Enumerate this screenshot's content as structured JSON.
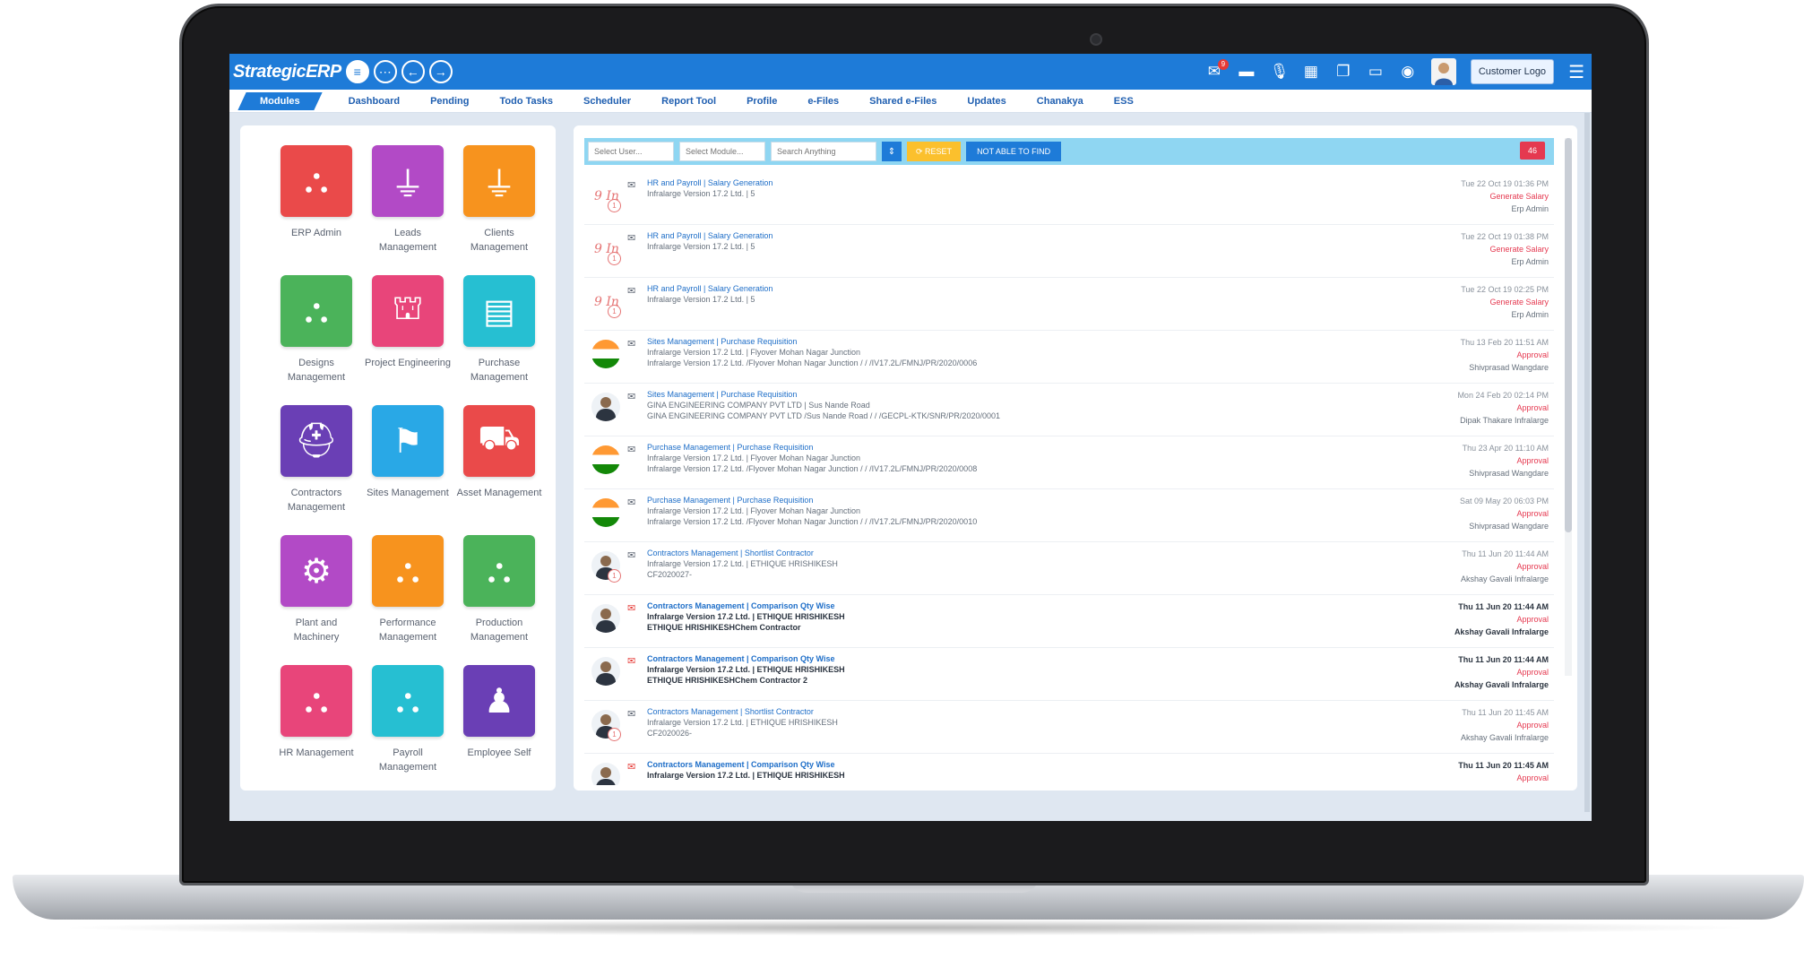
{
  "app": {
    "brand": "StrategicERP",
    "notification_count": "9",
    "customer_logo": "Customer Logo",
    "colors": {
      "topbar": "#1e7bd8",
      "accent_red": "#e53950",
      "reset": "#fbc02d",
      "filter_bar": "#8fd6f2"
    }
  },
  "nav": {
    "tabs": [
      "Modules",
      "Dashboard",
      "Pending",
      "Todo Tasks",
      "Scheduler",
      "Report Tool",
      "Profile",
      "e-Files",
      "Shared e-Files",
      "Updates",
      "Chanakya",
      "ESS"
    ]
  },
  "modules": [
    {
      "label": "ERP Admin",
      "color": "#ea4a4a",
      "icon": "org-chart-icon"
    },
    {
      "label": "Leads Management",
      "color": "#b24ac6",
      "icon": "funnel-icon"
    },
    {
      "label": "Clients Management",
      "color": "#f7931e",
      "icon": "funnel-icon"
    },
    {
      "label": "Designs Management",
      "color": "#4bb35a",
      "icon": "org-chart-icon"
    },
    {
      "label": "Project Engineering",
      "color": "#e8457a",
      "icon": "crane-icon"
    },
    {
      "label": "Purchase Management",
      "color": "#26bfd2",
      "icon": "invoice-icon"
    },
    {
      "label": "Contractors Management",
      "color": "#6a3fb5",
      "icon": "helmet-icon"
    },
    {
      "label": "Sites Management",
      "color": "#29a8e6",
      "icon": "signpost-icon"
    },
    {
      "label": "Asset Management",
      "color": "#ea4a4a",
      "icon": "wheelbarrow-icon"
    },
    {
      "label": "Plant and Machinery",
      "color": "#b24ac6",
      "icon": "gear-icon"
    },
    {
      "label": "Performance Management",
      "color": "#f7931e",
      "icon": "org-chart-icon"
    },
    {
      "label": "Production Management",
      "color": "#4bb35a",
      "icon": "org-chart-icon"
    },
    {
      "label": "HR Management",
      "color": "#e8457a",
      "icon": "org-chart-icon"
    },
    {
      "label": "Payroll Management",
      "color": "#26bfd2",
      "icon": "org-chart-icon"
    },
    {
      "label": "Employee Self",
      "color": "#6a3fb5",
      "icon": "user-icon"
    }
  ],
  "filters": {
    "user_placeholder": "Select User...",
    "module_placeholder": "Select Module...",
    "search_placeholder": "Search Anything",
    "reset_label": "RESET",
    "not_able_label": "NOT ABLE TO FIND",
    "count": "46"
  },
  "feed": [
    {
      "title": "HR and Payroll | Salary Generation",
      "line1": "Infralarge Version 17.2 Ltd. | 5",
      "line2": "",
      "date": "Tue 22 Oct 19 01:36 PM",
      "status": "Generate Salary",
      "user": "Erp Admin",
      "thumb": "infra",
      "sub": "1",
      "bold": false
    },
    {
      "title": "HR and Payroll | Salary Generation",
      "line1": "Infralarge Version 17.2 Ltd. | 5",
      "line2": "",
      "date": "Tue 22 Oct 19 01:38 PM",
      "status": "Generate Salary",
      "user": "Erp Admin",
      "thumb": "infra",
      "sub": "1",
      "bold": false
    },
    {
      "title": "HR and Payroll | Salary Generation",
      "line1": "Infralarge Version 17.2 Ltd. | 5",
      "line2": "",
      "date": "Tue 22 Oct 19 02:25 PM",
      "status": "Generate Salary",
      "user": "Erp Admin",
      "thumb": "infra",
      "sub": "1",
      "bold": false
    },
    {
      "title": "Sites Management | Purchase Requisition",
      "line1": "Infralarge Version 17.2 Ltd. | Flyover Mohan Nagar Junction",
      "line2": "Infralarge Version 17.2 Ltd. /Flyover Mohan Nagar Junction / / /IV17.2L/FMNJ/PR/2020/0006",
      "date": "Thu 13 Feb 20 11:51 AM",
      "status": "Approval",
      "user": "Shivprasad Wangdare",
      "thumb": "flag",
      "sub": "",
      "bold": false
    },
    {
      "title": "Sites Management | Purchase Requisition",
      "line1": "GINA ENGINEERING COMPANY PVT LTD | Sus Nande Road",
      "line2": "GINA ENGINEERING COMPANY PVT LTD /Sus Nande Road / / /GECPL-KTK/SNR/PR/2020/0001",
      "date": "Mon 24 Feb 20 02:14 PM",
      "status": "Approval",
      "user": "Dipak Thakare Infralarge",
      "thumb": "person",
      "sub": "",
      "bold": false
    },
    {
      "title": "Purchase Management | Purchase Requisition",
      "line1": "Infralarge Version 17.2 Ltd. | Flyover Mohan Nagar Junction",
      "line2": "Infralarge Version 17.2 Ltd. /Flyover Mohan Nagar Junction / / /IV17.2L/FMNJ/PR/2020/0008",
      "date": "Thu 23 Apr 20 11:10 AM",
      "status": "Approval",
      "user": "Shivprasad Wangdare",
      "thumb": "flag",
      "sub": "",
      "bold": false
    },
    {
      "title": "Purchase Management | Purchase Requisition",
      "line1": "Infralarge Version 17.2 Ltd. | Flyover Mohan Nagar Junction",
      "line2": "Infralarge Version 17.2 Ltd. /Flyover Mohan Nagar Junction / / /IV17.2L/FMNJ/PR/2020/0010",
      "date": "Sat 09 May 20 06:03 PM",
      "status": "Approval",
      "user": "Shivprasad Wangdare",
      "thumb": "flag",
      "sub": "",
      "bold": false
    },
    {
      "title": "Contractors Management | Shortlist Contractor",
      "line1": "Infralarge Version 17.2 Ltd. | ETHIQUE HRISHIKESH",
      "line2": "CF2020027-",
      "date": "Thu 11 Jun 20 11:44 AM",
      "status": "Approval",
      "user": "Akshay Gavali Infralarge",
      "thumb": "person",
      "sub": "1",
      "bold": false
    },
    {
      "title": "Contractors Management | Comparison Qty Wise",
      "line1": "Infralarge Version 17.2 Ltd. | ETHIQUE HRISHIKESH",
      "line2": "ETHIQUE HRISHIKESHChem Contractor",
      "date": "Thu 11 Jun 20 11:44 AM",
      "status": "Approval",
      "user": "Akshay Gavali Infralarge",
      "thumb": "person",
      "sub": "",
      "bold": true
    },
    {
      "title": "Contractors Management | Comparison Qty Wise",
      "line1": "Infralarge Version 17.2 Ltd. | ETHIQUE HRISHIKESH",
      "line2": "ETHIQUE HRISHIKESHChem Contractor 2",
      "date": "Thu 11 Jun 20 11:44 AM",
      "status": "Approval",
      "user": "Akshay Gavali Infralarge",
      "thumb": "person",
      "sub": "",
      "bold": true
    },
    {
      "title": "Contractors Management | Shortlist Contractor",
      "line1": "Infralarge Version 17.2 Ltd. | ETHIQUE HRISHIKESH",
      "line2": "CF2020026-",
      "date": "Thu 11 Jun 20 11:45 AM",
      "status": "Approval",
      "user": "Akshay Gavali Infralarge",
      "thumb": "person",
      "sub": "1",
      "bold": false
    },
    {
      "title": "Contractors Management | Comparison Qty Wise",
      "line1": "Infralarge Version 17.2 Ltd. | ETHIQUE HRISHIKESH",
      "line2": "",
      "date": "Thu 11 Jun 20 11:45 AM",
      "status": "Approval",
      "user": "",
      "thumb": "person",
      "sub": "",
      "bold": true
    }
  ]
}
